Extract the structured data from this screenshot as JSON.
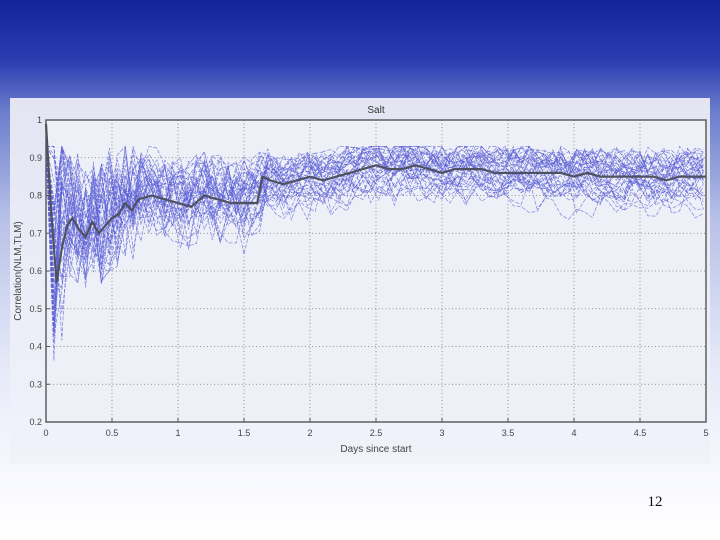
{
  "slide": {
    "number": "12"
  },
  "chart_data": {
    "type": "line",
    "title": "Salt",
    "xlabel": "Days since start",
    "ylabel": "Correlation(NLM,TLM)",
    "xlim": [
      0,
      5
    ],
    "ylim": [
      0.2,
      1
    ],
    "x_ticks": [
      "0",
      "0.5",
      "1",
      "1.5",
      "2",
      "2.5",
      "3",
      "3.5",
      "4",
      "4.5",
      "5"
    ],
    "y_ticks": [
      "0.2",
      "0.3",
      "0.4",
      "0.5",
      "0.6",
      "0.7",
      "0.8",
      "0.9",
      "1"
    ],
    "grid": true,
    "colors": {
      "ensemble": "#5a5fd6",
      "mean": "#4f5060",
      "axes": "#555555",
      "grid": "#777777"
    },
    "ensemble_description_count": 40,
    "mean_series": {
      "x": [
        0,
        0.04,
        0.08,
        0.12,
        0.16,
        0.2,
        0.25,
        0.3,
        0.35,
        0.4,
        0.45,
        0.5,
        0.55,
        0.6,
        0.65,
        0.7,
        0.8,
        0.9,
        1.0,
        1.1,
        1.2,
        1.3,
        1.4,
        1.5,
        1.6,
        1.64,
        1.7,
        1.8,
        1.9,
        2.0,
        2.1,
        2.2,
        2.3,
        2.4,
        2.5,
        2.6,
        2.7,
        2.8,
        2.9,
        3.0,
        3.1,
        3.2,
        3.3,
        3.4,
        3.5,
        3.6,
        3.7,
        3.8,
        3.9,
        4.0,
        4.1,
        4.2,
        4.3,
        4.4,
        4.5,
        4.6,
        4.7,
        4.8,
        4.9,
        5.0
      ],
      "y": [
        0.99,
        0.75,
        0.57,
        0.66,
        0.72,
        0.74,
        0.71,
        0.69,
        0.73,
        0.7,
        0.72,
        0.74,
        0.75,
        0.78,
        0.76,
        0.79,
        0.8,
        0.79,
        0.78,
        0.77,
        0.8,
        0.79,
        0.78,
        0.78,
        0.78,
        0.85,
        0.84,
        0.83,
        0.84,
        0.85,
        0.84,
        0.85,
        0.86,
        0.87,
        0.88,
        0.87,
        0.87,
        0.88,
        0.87,
        0.86,
        0.87,
        0.87,
        0.87,
        0.86,
        0.86,
        0.86,
        0.86,
        0.86,
        0.86,
        0.85,
        0.86,
        0.85,
        0.85,
        0.85,
        0.85,
        0.85,
        0.84,
        0.85,
        0.85,
        0.85
      ]
    }
  }
}
